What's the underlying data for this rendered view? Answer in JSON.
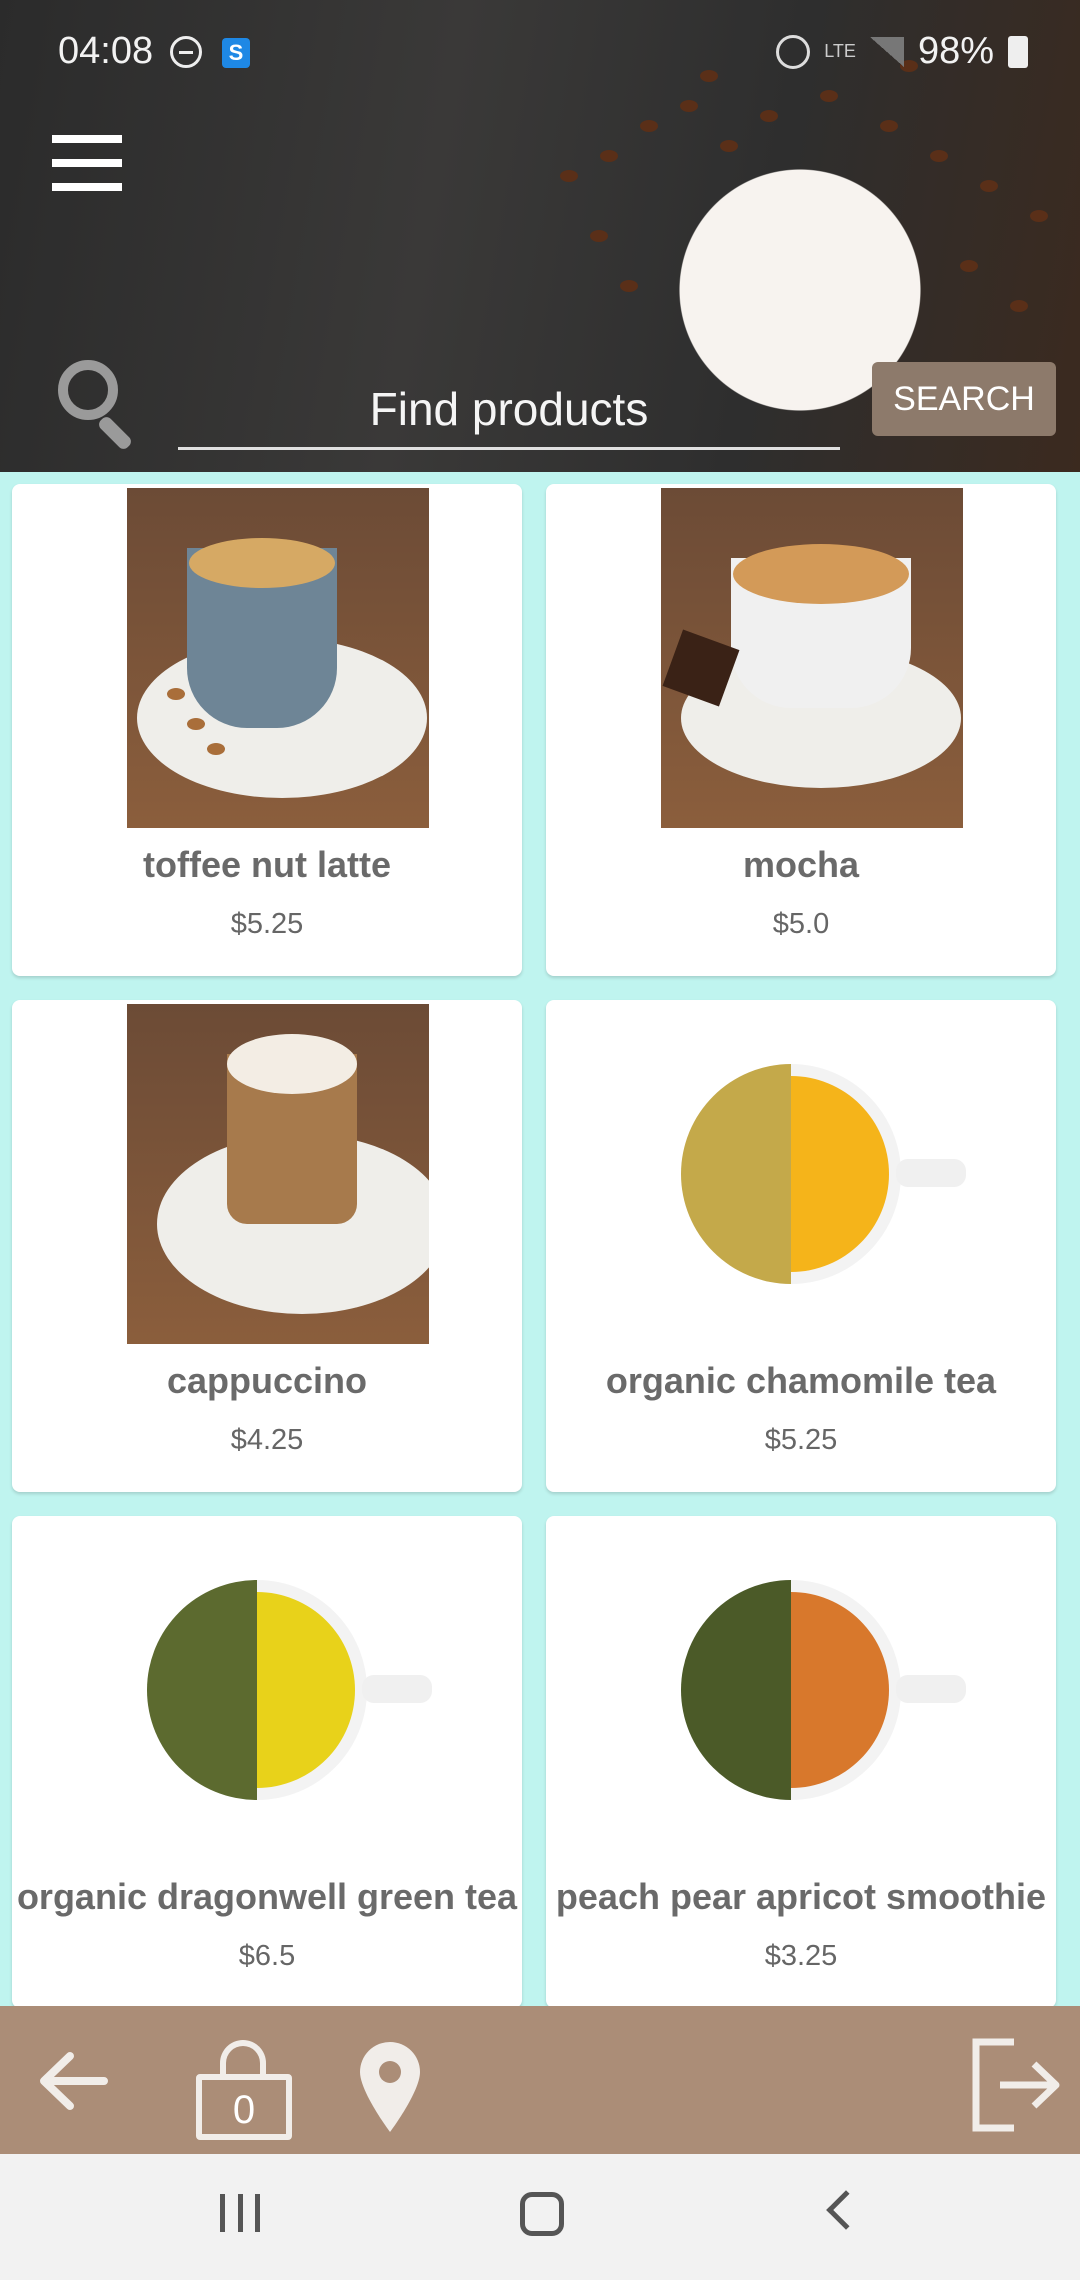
{
  "status_bar": {
    "time": "04:08",
    "network": "LTE",
    "battery": "98%"
  },
  "search": {
    "placeholder": "Find products",
    "button_label": "SEARCH"
  },
  "products": [
    {
      "name": "toffee nut latte",
      "price": "$5.25"
    },
    {
      "name": "mocha",
      "price": "$5.0"
    },
    {
      "name": "cappuccino",
      "price": "$4.25"
    },
    {
      "name": "organic chamomile tea",
      "price": "$5.25"
    },
    {
      "name": "organic dragonwell green tea",
      "price": "$6.5"
    },
    {
      "name": "peach pear apricot smoothie",
      "price": "$3.25"
    }
  ],
  "cart": {
    "count": "0"
  },
  "colors": {
    "background": "#bff4ef",
    "action_bar": "#ab8d77",
    "search_button": "#8d7a6b",
    "product_text": "#6a6a6a"
  },
  "icons": [
    "menu-icon",
    "search-icon",
    "back-arrow-icon",
    "shopping-bag-icon",
    "location-pin-icon",
    "logout-icon"
  ]
}
